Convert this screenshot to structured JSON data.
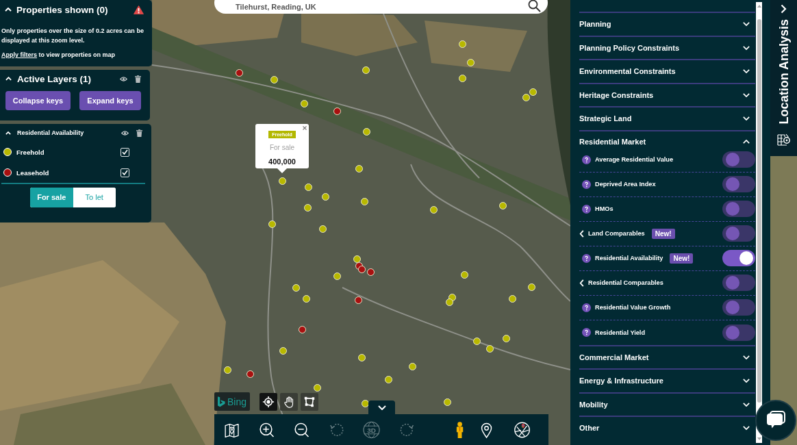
{
  "properties_panel": {
    "title": "Properties shown (0)",
    "expanded": true,
    "message": "Only properties over the size of 0.2 acres can be displayed at this zoom level.",
    "hint": {
      "link": "Apply filters",
      "text": "to view properties on map"
    }
  },
  "active_layers": {
    "title": "Active Layers (1)",
    "expanded": true,
    "buttons": [
      "Collapse keys",
      "Expand keys"
    ]
  },
  "layer_keys": [
    {
      "title": "Residential Availability",
      "expanded": true,
      "items": [
        {
          "label": "Freehold",
          "color": "#b8b800",
          "checked": true
        },
        {
          "label": "Leasehold",
          "color": "#a81010",
          "checked": true
        }
      ],
      "segments": [
        {
          "label": "For sale",
          "selected": true
        },
        {
          "label": "To let",
          "selected": false
        }
      ]
    }
  ],
  "search": {
    "value": "Tilehurst, Reading, UK"
  },
  "map": {
    "markers": [
      {
        "color": "#b8b800"
      },
      {
        "color": "#b8b800"
      },
      {
        "color": "#b8b800"
      },
      {
        "color": "#a81010"
      },
      {
        "color": "#b8b800"
      },
      {
        "color": "#b8b800"
      },
      {
        "color": "#b8b800"
      },
      {
        "color": "#b8b800"
      },
      {
        "color": "#b8b800"
      },
      {
        "color": "#a81010"
      },
      {
        "color": "#b8b800"
      },
      {
        "color": "#b8b800"
      },
      {
        "color": "#b8b800"
      },
      {
        "color": "#b8b800"
      },
      {
        "color": "#b8b800"
      },
      {
        "color": "#b8b800"
      },
      {
        "color": "#b8b800"
      },
      {
        "color": "#b8b800"
      },
      {
        "color": "#b8b800"
      },
      {
        "color": "#b8b800"
      },
      {
        "color": "#b8b800"
      },
      {
        "color": "#b8b800"
      },
      {
        "color": "#a81010"
      },
      {
        "color": "#a81010"
      },
      {
        "color": "#a81010"
      },
      {
        "color": "#b8b800"
      },
      {
        "color": "#b8b800"
      },
      {
        "color": "#b8b800"
      },
      {
        "color": "#b8b800"
      },
      {
        "color": "#b8b800"
      },
      {
        "color": "#b8b800"
      },
      {
        "color": "#a81010"
      },
      {
        "color": "#b8b800"
      },
      {
        "color": "#b8b800"
      },
      {
        "color": "#a81010"
      },
      {
        "color": "#b8b800"
      },
      {
        "color": "#b8b800"
      },
      {
        "color": "#b8b800"
      },
      {
        "color": "#b8b800"
      },
      {
        "color": "#b8b800"
      },
      {
        "color": "#b8b800"
      },
      {
        "color": "#b8b800"
      },
      {
        "color": "#a81010"
      },
      {
        "color": "#b8b800"
      },
      {
        "color": "#b8b800"
      },
      {
        "color": "#b8b800"
      },
      {
        "color": "#b8b800"
      }
    ],
    "popup": {
      "tag": "Freehold",
      "status": "For sale",
      "price": "400,000"
    }
  },
  "attribution": "Bing",
  "map_tools": [
    {
      "kind": "locate",
      "selected": true
    },
    {
      "kind": "pan",
      "selected": false
    },
    {
      "kind": "draw",
      "selected": false
    }
  ],
  "toolbar": {
    "expanded": true,
    "tools": [
      {
        "kind": "map",
        "disabled": false
      },
      {
        "kind": "zoom-in",
        "disabled": false
      },
      {
        "kind": "zoom-out",
        "disabled": false
      },
      {
        "kind": "rotate-left",
        "disabled": true
      },
      {
        "kind": "view-3d",
        "label": "3D",
        "disabled": true
      },
      {
        "kind": "rotate-right",
        "disabled": true
      },
      {
        "kind": "street-view",
        "disabled": false
      },
      {
        "kind": "pin",
        "disabled": false
      },
      {
        "kind": "maps",
        "disabled": false
      }
    ]
  },
  "layers_panel": {
    "sections": [
      {
        "title": "Planning",
        "expanded": false
      },
      {
        "title": "Planning Policy Constraints",
        "expanded": false
      },
      {
        "title": "Environmental Constraints",
        "expanded": false
      },
      {
        "title": "Heritage Constraints",
        "expanded": false
      },
      {
        "title": "Strategic Land",
        "expanded": false
      },
      {
        "title": "Residential Market",
        "expanded": true,
        "items": [
          {
            "kind": "info",
            "label": "Average Residential Value",
            "on": false
          },
          {
            "kind": "info",
            "label": "Deprived Area Index",
            "on": false
          },
          {
            "kind": "info",
            "label": "HMOs",
            "on": false
          },
          {
            "kind": "submenu",
            "label": "Land Comparables",
            "badge": "New!",
            "on": false
          },
          {
            "kind": "info",
            "label": "Residential Availability",
            "badge": "New!",
            "on": true
          },
          {
            "kind": "submenu",
            "label": "Residential Comparables",
            "on": false
          },
          {
            "kind": "info",
            "label": "Residential Value Growth",
            "on": false
          },
          {
            "kind": "info",
            "label": "Residential Yield",
            "on": false
          }
        ]
      },
      {
        "title": "Commercial Market",
        "expanded": false
      },
      {
        "title": "Energy & Infrastructure",
        "expanded": false
      },
      {
        "title": "Mobility",
        "expanded": false
      },
      {
        "title": "Other",
        "expanded": false
      }
    ]
  },
  "side_tab": {
    "label": "Location Analysis"
  }
}
